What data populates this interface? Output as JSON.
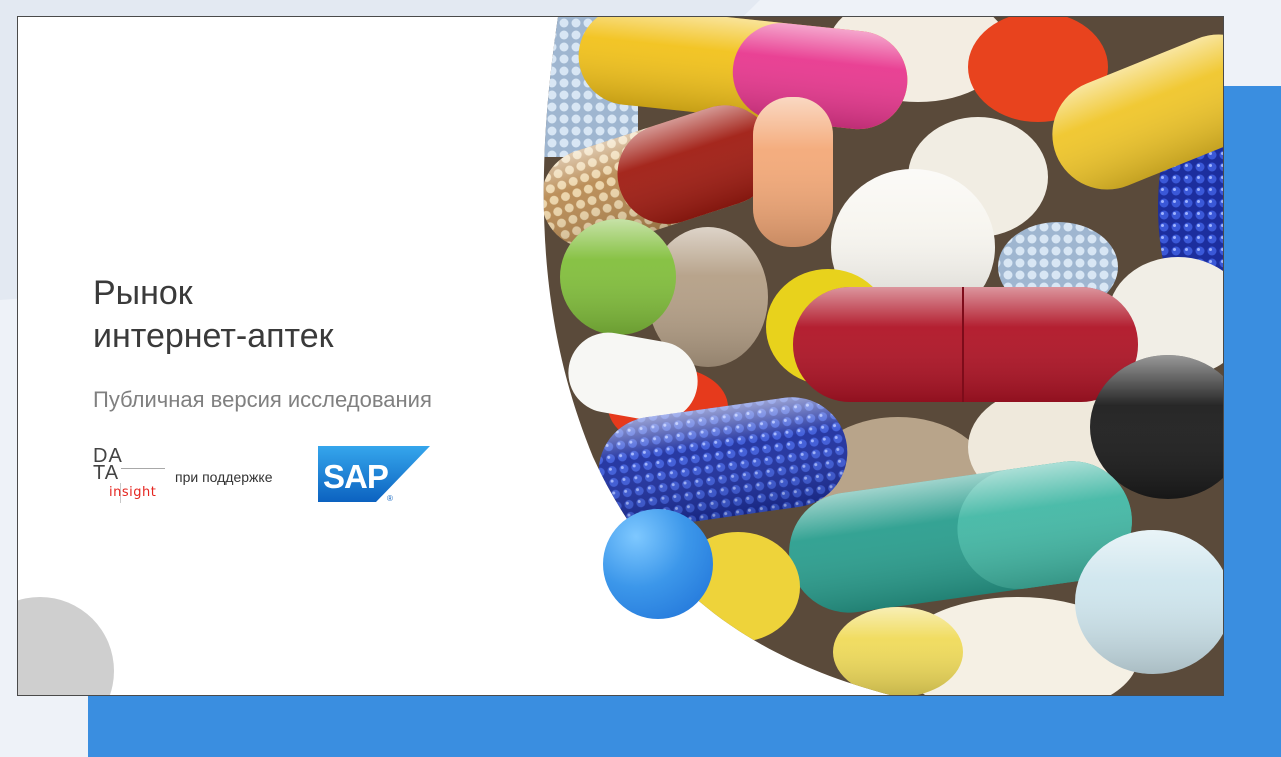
{
  "slide": {
    "title_line1": "Рынок",
    "title_line2": "интернет-аптек",
    "subtitle": "Публичная версия исследования",
    "support_text": "при поддержке"
  },
  "logos": {
    "data_insight": {
      "line1": "DA",
      "line2": "TA",
      "tagline": "insight"
    },
    "sap": {
      "wordmark": "SAP",
      "mark": "®"
    }
  },
  "colors": {
    "accent_blue": "#3a8ee0",
    "title_text": "#3a3a3a",
    "subtitle_text": "#808080",
    "insight_red": "#e5251f",
    "sap_blue": "#1a7fd4"
  },
  "icons": [
    "pills-photo",
    "data-insight-logo",
    "sap-logo"
  ]
}
